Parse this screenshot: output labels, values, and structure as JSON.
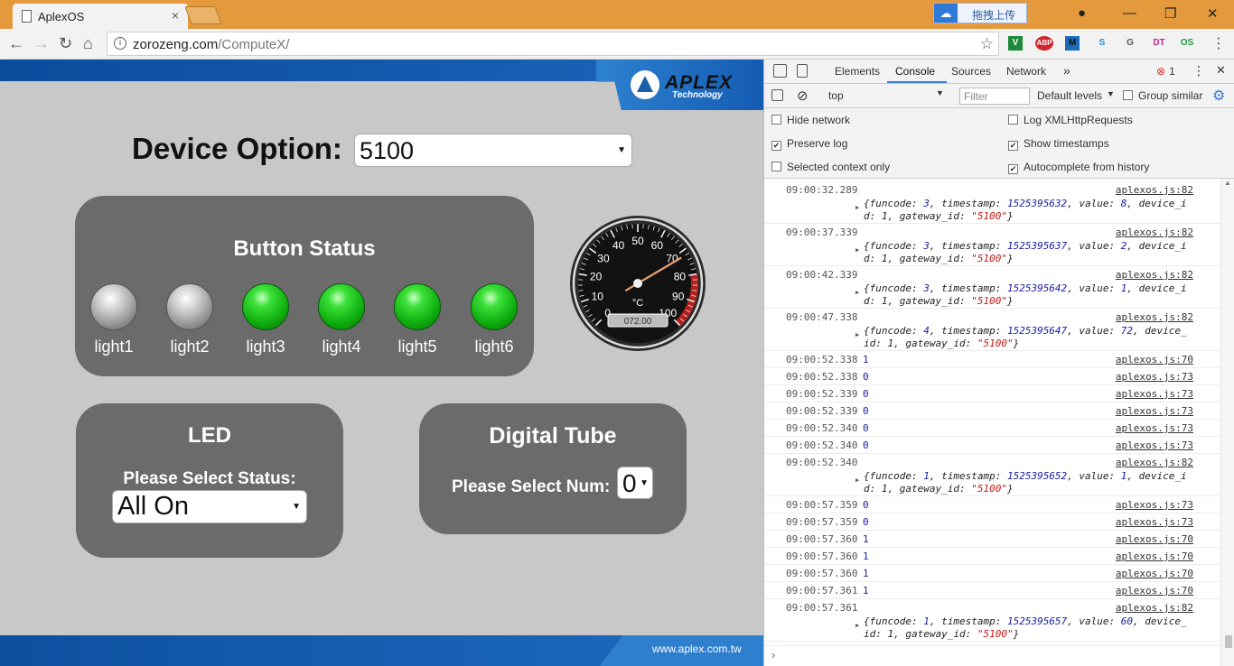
{
  "browser": {
    "tab_title": "AplexOS",
    "tab_close": "×",
    "upload_label": "拖拽上传",
    "url_host": "zorozeng.com",
    "url_path": "/ComputeX/",
    "extensions": [
      "V",
      "ABP",
      "M",
      "S",
      "G",
      "DT",
      "OS"
    ]
  },
  "page": {
    "logo_text": "APLEX",
    "logo_sub": "Technology",
    "device_option_label": "Device Option:",
    "device_option_value": "5100",
    "button_status_title": "Button Status",
    "lights": [
      {
        "label": "light1",
        "state": "off"
      },
      {
        "label": "light2",
        "state": "off"
      },
      {
        "label": "light3",
        "state": "on"
      },
      {
        "label": "light4",
        "state": "on"
      },
      {
        "label": "light5",
        "state": "on"
      },
      {
        "label": "light6",
        "state": "on"
      }
    ],
    "gauge": {
      "ticks": [
        "0",
        "10",
        "20",
        "30",
        "40",
        "50",
        "60",
        "70",
        "80",
        "90",
        "100"
      ],
      "unit": "°C",
      "readout": "072.00",
      "value": 72
    },
    "led_title": "LED",
    "led_select_label": "Please Select Status:",
    "led_select_value": "All On",
    "tube_title": "Digital Tube",
    "tube_select_label": "Please Select Num:",
    "tube_select_value": "0",
    "footer_url": "www.aplex.com.tw"
  },
  "devtools": {
    "tabs": [
      "Elements",
      "Console",
      "Sources",
      "Network"
    ],
    "more": "»",
    "error_count": "1",
    "context": "top",
    "filter_placeholder": "Filter",
    "levels": "Default levels",
    "group_similar": "Group similar",
    "options": [
      {
        "label": "Hide network",
        "checked": false
      },
      {
        "label": "Log XMLHttpRequests",
        "checked": false
      },
      {
        "label": "Preserve log",
        "checked": true
      },
      {
        "label": "Show timestamps",
        "checked": true
      },
      {
        "label": "Selected context only",
        "checked": false
      },
      {
        "label": "Autocomplete from history",
        "checked": true
      }
    ],
    "logs": [
      {
        "ts": "09:00:32.289",
        "src": "aplexos.js:82",
        "obj": {
          "funcode": 3,
          "timestamp": 1525395632,
          "value": 8,
          "wrap": "device_i",
          "tail": "d: 1, gateway_id: ",
          "gw": "\"5100\""
        }
      },
      {
        "ts": "09:00:37.339",
        "src": "aplexos.js:82",
        "obj": {
          "funcode": 3,
          "timestamp": 1525395637,
          "value": 2,
          "wrap": "device_i",
          "tail": "d: 1, gateway_id: ",
          "gw": "\"5100\""
        }
      },
      {
        "ts": "09:00:42.339",
        "src": "aplexos.js:82",
        "obj": {
          "funcode": 3,
          "timestamp": 1525395642,
          "value": 1,
          "wrap": "device_i",
          "tail": "d: 1, gateway_id: ",
          "gw": "\"5100\""
        }
      },
      {
        "ts": "09:00:47.338",
        "src": "aplexos.js:82",
        "obj": {
          "funcode": 4,
          "timestamp": 1525395647,
          "value": 72,
          "wrap": "device_",
          "tail": "id: 1, gateway_id: ",
          "gw": "\"5100\""
        }
      },
      {
        "ts": "09:00:52.338",
        "src": "aplexos.js:70",
        "val": "1"
      },
      {
        "ts": "09:00:52.338",
        "src": "aplexos.js:73",
        "val": "0"
      },
      {
        "ts": "09:00:52.339",
        "src": "aplexos.js:73",
        "val": "0"
      },
      {
        "ts": "09:00:52.339",
        "src": "aplexos.js:73",
        "val": "0"
      },
      {
        "ts": "09:00:52.340",
        "src": "aplexos.js:73",
        "val": "0"
      },
      {
        "ts": "09:00:52.340",
        "src": "aplexos.js:73",
        "val": "0"
      },
      {
        "ts": "09:00:52.340",
        "src": "aplexos.js:82",
        "obj": {
          "funcode": 1,
          "timestamp": 1525395652,
          "value": 1,
          "wrap": "device_i",
          "tail": "d: 1, gateway_id: ",
          "gw": "\"5100\""
        }
      },
      {
        "ts": "09:00:57.359",
        "src": "aplexos.js:73",
        "val": "0"
      },
      {
        "ts": "09:00:57.359",
        "src": "aplexos.js:73",
        "val": "0"
      },
      {
        "ts": "09:00:57.360",
        "src": "aplexos.js:70",
        "val": "1"
      },
      {
        "ts": "09:00:57.360",
        "src": "aplexos.js:70",
        "val": "1"
      },
      {
        "ts": "09:00:57.360",
        "src": "aplexos.js:70",
        "val": "1"
      },
      {
        "ts": "09:00:57.361",
        "src": "aplexos.js:70",
        "val": "1"
      },
      {
        "ts": "09:00:57.361",
        "src": "aplexos.js:82",
        "obj": {
          "funcode": 1,
          "timestamp": 1525395657,
          "value": 60,
          "wrap": "device_",
          "tail": "id: 1, gateway_id: ",
          "gw": "\"5100\""
        }
      }
    ],
    "prompt": "›"
  },
  "colors": {
    "panel": "#6b6b6b",
    "page_bg": "#c8c8c8",
    "light_on": "#10b00f",
    "accent": "#3879d9"
  }
}
